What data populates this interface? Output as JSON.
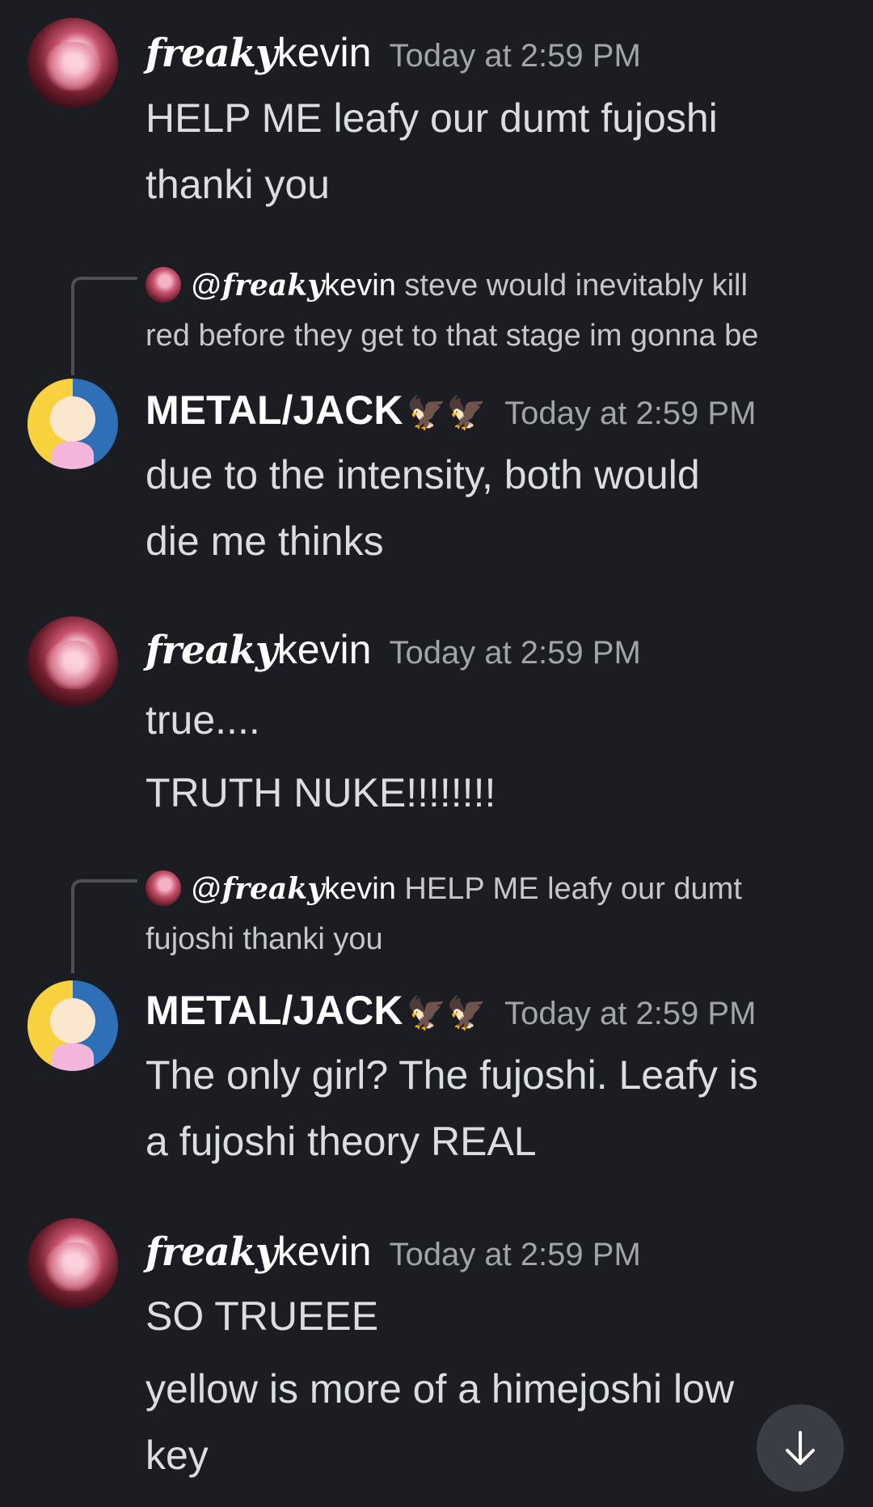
{
  "messages": [
    {
      "author_prefix": "freaky",
      "author": "kevin",
      "time": "Today at 2:59 PM",
      "lines": [
        "HELP ME leafy our dumt fujoshi",
        "thanki you"
      ]
    },
    {
      "reply": {
        "at": "@",
        "mention_prefix": "freaky",
        "mention_name": "kevin",
        "text_line1": "steve would inevitably kill",
        "text_line2": "red before they get to that stage im gonna be"
      },
      "author": "METAL/JACK",
      "author_emoji": "🦅🦅",
      "time": "Today at 2:59 PM",
      "lines": [
        "due to the intensity, both would",
        "die me thinks"
      ]
    },
    {
      "author_prefix": "freaky",
      "author": "kevin",
      "time": "Today at 2:59 PM",
      "lines": [
        "true....",
        "TRUTH NUKE!!!!!!!!"
      ]
    },
    {
      "reply": {
        "at": "@",
        "mention_prefix": "freaky",
        "mention_name": "kevin",
        "text_line1": "HELP ME leafy our dumt",
        "text_line2": "fujoshi thanki you"
      },
      "author": "METAL/JACK",
      "author_emoji": "🦅🦅",
      "time": "Today at 2:59 PM",
      "lines": [
        "The only girl? The fujoshi. Leafy is",
        "a fujoshi theory REAL"
      ]
    },
    {
      "author_prefix": "freaky",
      "author": "kevin",
      "time": "Today at 2:59 PM",
      "lines": [
        "SO TRUEEE",
        "yellow is more of  a himejoshi low",
        "key"
      ]
    }
  ],
  "icons": {
    "scroll": "arrow-down-icon"
  },
  "colors": {
    "background": "#1c1d22",
    "text": "#dbdee1",
    "timestamp": "#a0a4ab",
    "scroll_button": "#3b3d44"
  }
}
